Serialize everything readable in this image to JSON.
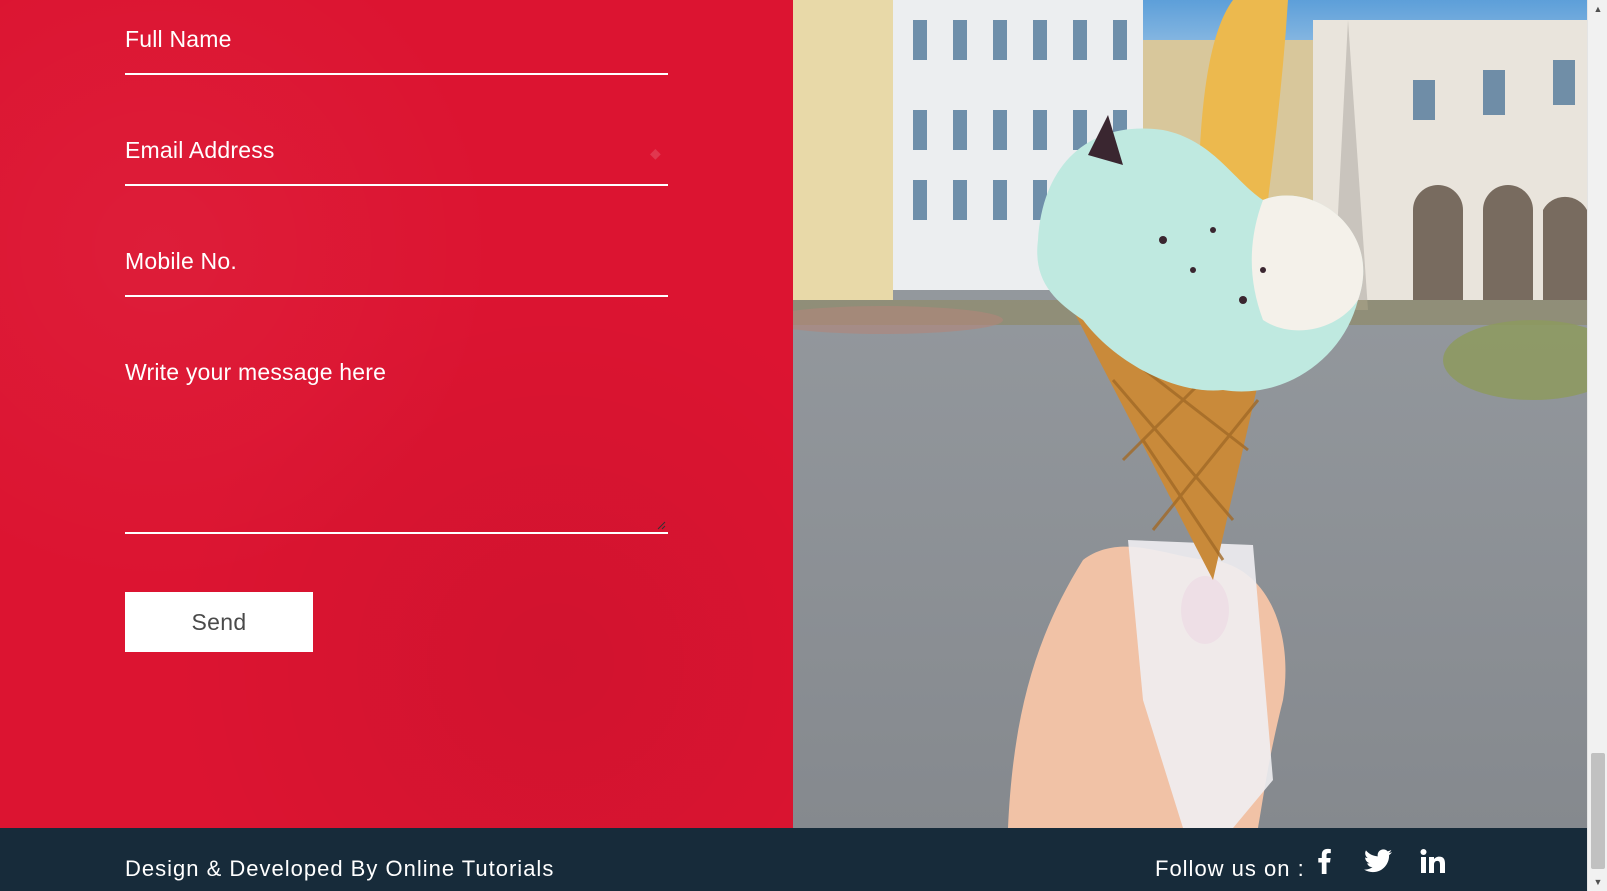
{
  "contact_form": {
    "full_name_placeholder": "Full Name",
    "email_placeholder": "Email Address",
    "mobile_placeholder": "Mobile No.",
    "message_placeholder": "Write your message here",
    "send_label": "Send"
  },
  "footer": {
    "credit": "Design & Developed By Online Tutorials",
    "follow_label": "Follow us on :",
    "social": [
      "facebook-icon",
      "twitter-icon",
      "linkedin-icon"
    ]
  },
  "colors": {
    "form_background": "#dc1431",
    "footer_background": "#172b3a",
    "button_background": "#ffffff"
  }
}
